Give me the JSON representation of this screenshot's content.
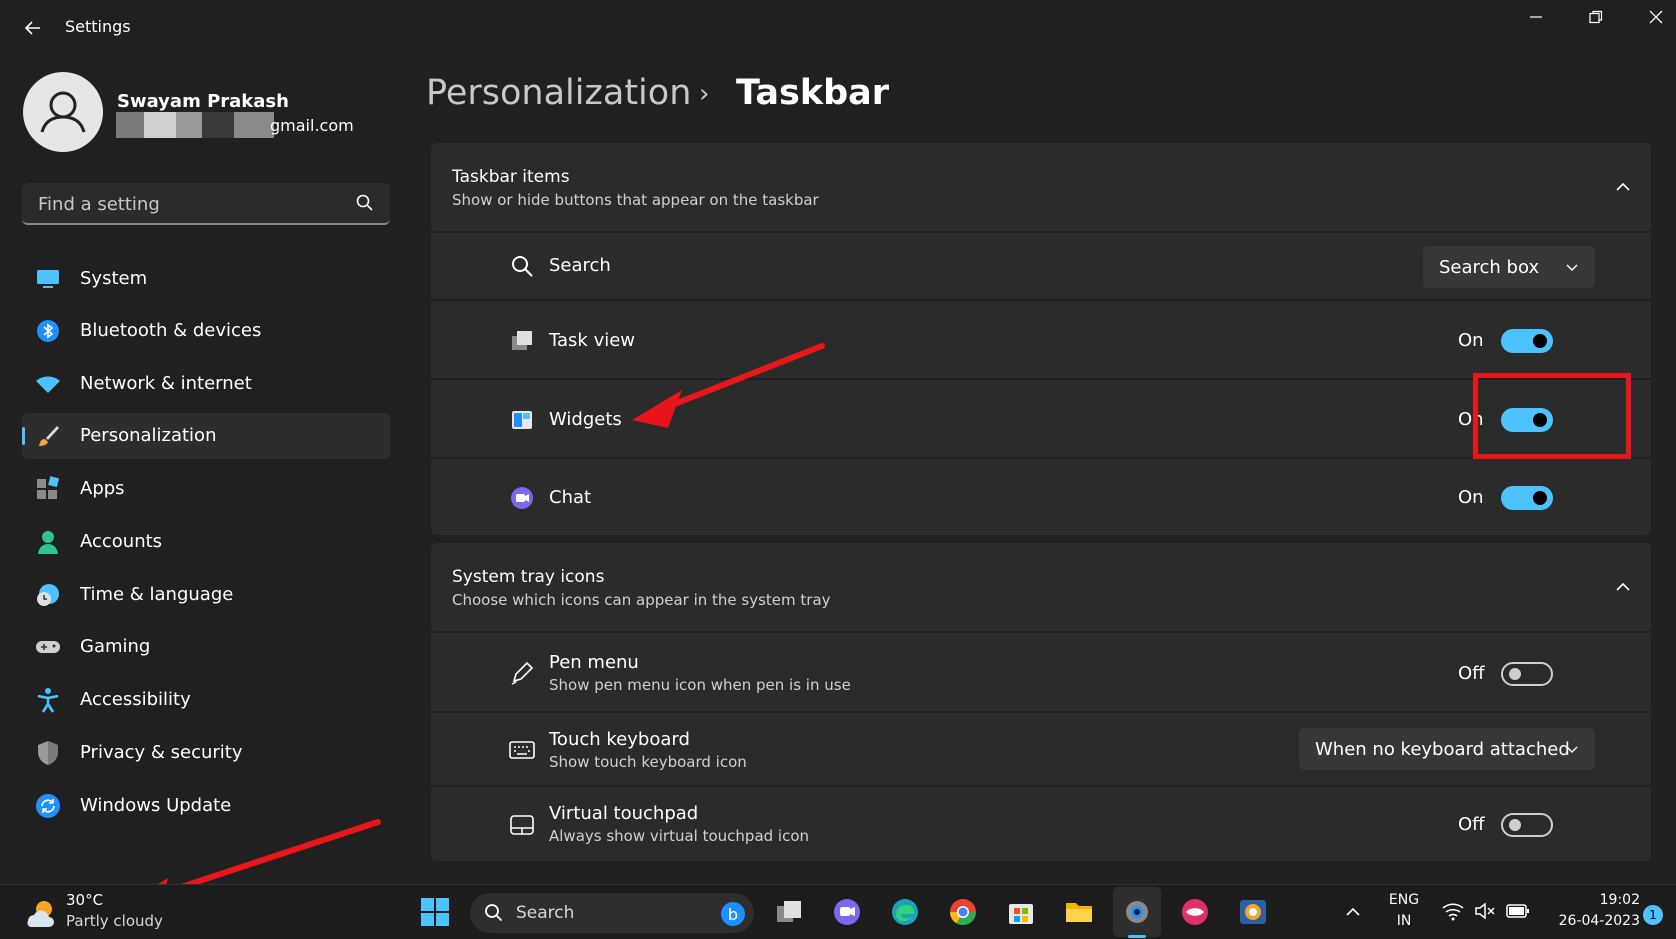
{
  "window": {
    "title": "Settings"
  },
  "user": {
    "name": "Swayam Prakash",
    "email_visible": "gmail.com"
  },
  "search": {
    "placeholder": "Find a setting"
  },
  "sidebar": {
    "items": [
      {
        "label": "System",
        "icon": "monitor-icon"
      },
      {
        "label": "Bluetooth & devices",
        "icon": "bluetooth-icon"
      },
      {
        "label": "Network & internet",
        "icon": "wifi-icon"
      },
      {
        "label": "Personalization",
        "icon": "brush-icon",
        "active": true
      },
      {
        "label": "Apps",
        "icon": "apps-icon"
      },
      {
        "label": "Accounts",
        "icon": "person-icon"
      },
      {
        "label": "Time & language",
        "icon": "globe-clock-icon"
      },
      {
        "label": "Gaming",
        "icon": "gamepad-icon"
      },
      {
        "label": "Accessibility",
        "icon": "accessibility-icon"
      },
      {
        "label": "Privacy & security",
        "icon": "shield-icon"
      },
      {
        "label": "Windows Update",
        "icon": "update-icon"
      }
    ]
  },
  "breadcrumb": {
    "parent": "Personalization",
    "separator": "›",
    "current": "Taskbar"
  },
  "taskbar_items": {
    "title": "Taskbar items",
    "subtitle": "Show or hide buttons that appear on the taskbar",
    "search": {
      "label": "Search",
      "value": "Search box"
    },
    "task_view": {
      "label": "Task view",
      "state": "On"
    },
    "widgets": {
      "label": "Widgets",
      "state": "On"
    },
    "chat": {
      "label": "Chat",
      "state": "On"
    }
  },
  "system_tray": {
    "title": "System tray icons",
    "subtitle": "Choose which icons can appear in the system tray",
    "pen_menu": {
      "label": "Pen menu",
      "desc": "Show pen menu icon when pen is in use",
      "state": "Off"
    },
    "touch_keyboard": {
      "label": "Touch keyboard",
      "desc": "Show touch keyboard icon",
      "value": "When no keyboard attached"
    },
    "virtual_touchpad": {
      "label": "Virtual touchpad",
      "desc": "Always show virtual touchpad icon",
      "state": "Off"
    }
  },
  "taskbar": {
    "weather": {
      "temp": "30°C",
      "desc": "Partly cloudy"
    },
    "search_label": "Search",
    "lang": {
      "line1": "ENG",
      "line2": "IN"
    },
    "time": "19:02",
    "date": "26-04-2023",
    "notifications": "1"
  },
  "colors": {
    "accent": "#4cc2ff",
    "highlight": "#e8151b",
    "background": "#202020",
    "card": "#2b2b2b"
  }
}
